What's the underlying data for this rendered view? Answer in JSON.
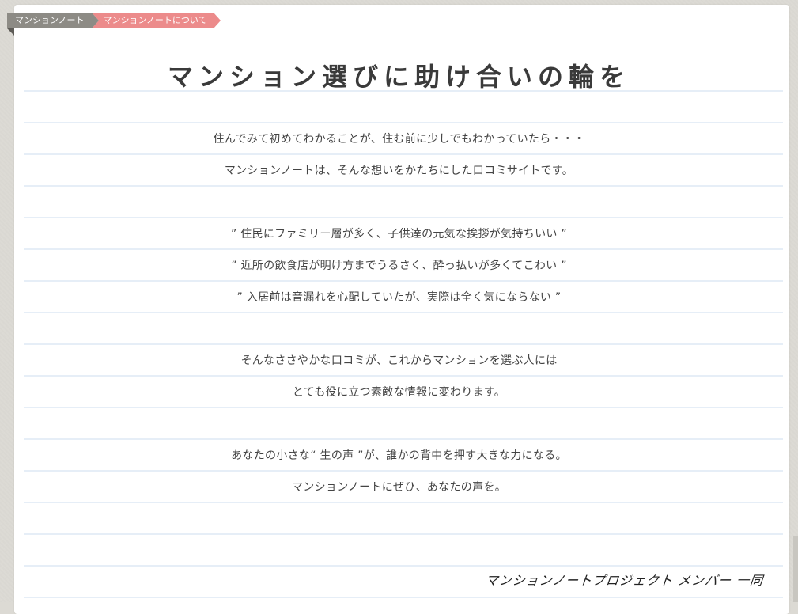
{
  "breadcrumb": {
    "home_label": "マンションノート",
    "current_label": "マンションノートについて"
  },
  "page": {
    "title": "マンション選びに助け合いの輪を",
    "paragraphs": [
      "住んでみて初めてわかることが、住む前に少しでもわかっていたら・・・",
      "マンションノートは、そんな想いをかたちにした口コミサイトです。",
      "",
      "” 住民にファミリー層が多く、子供達の元気な挨拶が気持ちいい ”",
      "” 近所の飲食店が明け方までうるさく、酔っ払いが多くてこわい ”",
      "” 入居前は音漏れを心配していたが、実際は全く気にならない ”",
      "",
      "そんなささやかな口コミが、これからマンションを選ぶ人には",
      "とても役に立つ素敵な情報に変わります。",
      "",
      "あなたの小さな“ 生の声 ”が、誰かの背中を押す大きな力になる。",
      "マンションノートにぜひ、あなたの声を。"
    ],
    "signature": "マンションノートプロジェクト メンバー 一同"
  },
  "colors": {
    "breadcrumb_home": "#8d8b85",
    "breadcrumb_current": "#ec8b8b",
    "rule_line": "#e6eef7",
    "background": "#dcdad4"
  }
}
